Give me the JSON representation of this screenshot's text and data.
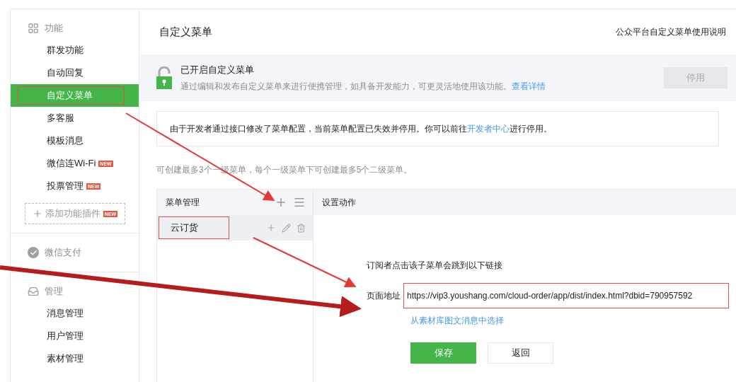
{
  "sidebar": {
    "sections": [
      {
        "title": "功能",
        "items": [
          {
            "label": "群发功能",
            "selected": false,
            "highlighted": false
          },
          {
            "label": "自动回复",
            "selected": false,
            "highlighted": false
          },
          {
            "label": "自定义菜单",
            "selected": true,
            "highlighted": true
          },
          {
            "label": "多客服",
            "selected": false,
            "highlighted": false
          },
          {
            "label": "模板消息",
            "selected": false,
            "highlighted": false
          },
          {
            "label": "微信连Wi-Fi",
            "selected": false,
            "badge": "NEW",
            "highlighted": false
          },
          {
            "label": "投票管理",
            "selected": false,
            "badge": "NEW",
            "highlighted": false
          }
        ],
        "add_button": {
          "label": "添加功能插件",
          "badge": "NEW"
        }
      },
      {
        "title": "微信支付"
      },
      {
        "title": "管理",
        "items": [
          {
            "label": "消息管理",
            "selected": false,
            "highlighted": false
          },
          {
            "label": "用户管理",
            "selected": false,
            "highlighted": false
          },
          {
            "label": "素材管理",
            "selected": false,
            "highlighted": false
          }
        ]
      }
    ]
  },
  "page": {
    "title": "自定义菜单",
    "help_link": "公众平台自定义菜单使用说明"
  },
  "status_banner": {
    "title": "已开启自定义菜单",
    "description": "通过编辑和发布自定义菜单来进行便携管理，如具备开发能力，可更灵活地使用该功能。",
    "link": "查看详情",
    "button": {
      "label": "停用",
      "disabled": true
    }
  },
  "notice": {
    "text_before": "由于开发者通过接口修改了菜单配置，当前菜单配置已失效并停用。你可以前往",
    "link": "开发者中心",
    "text_after": "进行停用。"
  },
  "hint": "可创建最多3个一级菜单，每个一级菜单下可创建最多5个二级菜单。",
  "menu_panel": {
    "title": "菜单管理",
    "items": [
      {
        "label": "云订货",
        "selected": true,
        "highlighted": true
      }
    ]
  },
  "action_panel": {
    "title": "设置动作",
    "description": "订阅者点击该子菜单会跳到以下链接",
    "url_label": "页面地址",
    "url_value": "https://vip3.youshang.com/cloud-order/app/dist/index.html?dbid=790957592",
    "url_highlighted": true,
    "library_link": "从素材库图文消息中选择",
    "buttons": [
      {
        "label": "保存",
        "kind": "primary"
      },
      {
        "label": "返回",
        "kind": "secondary"
      }
    ]
  }
}
